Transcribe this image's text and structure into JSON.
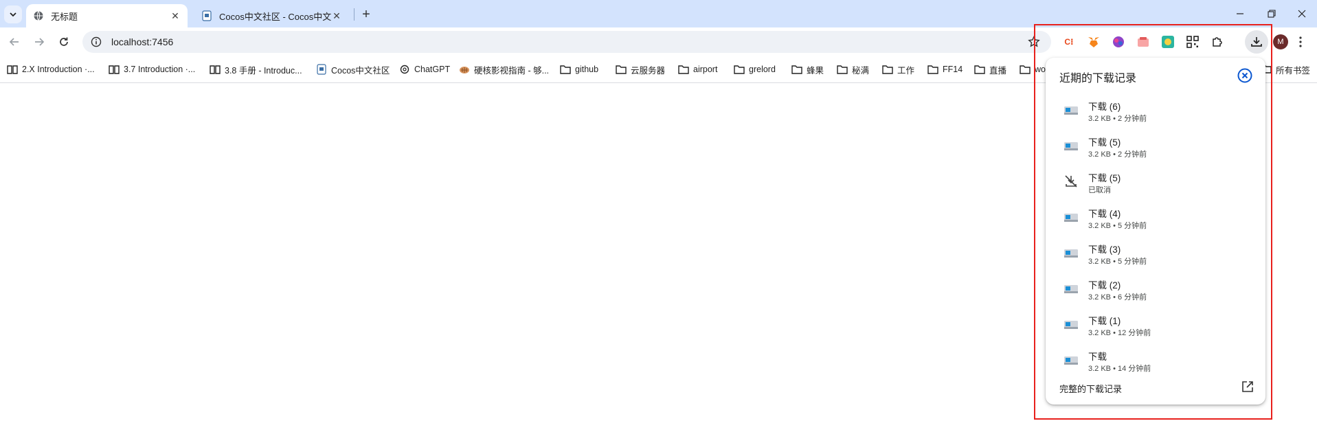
{
  "tabs": [
    {
      "title": "无标题",
      "favicon": "globe-icon",
      "active": true
    },
    {
      "title": "Cocos中文社区 - Cocos中文社",
      "favicon": "cocos-icon",
      "active": false
    }
  ],
  "address": {
    "url": "localhost:7456"
  },
  "toolbar": {
    "extensions": [
      "c-logo-icon",
      "metamask-icon",
      "brain-icon",
      "toolbox-icon",
      "translate-icon",
      "qr-code-icon",
      "puzzle-icon"
    ],
    "avatar_letter": "M"
  },
  "bookmarks": [
    {
      "label": "2.X Introduction ·...",
      "icon": "book-icon"
    },
    {
      "label": "3.7 Introduction ·...",
      "icon": "book-icon"
    },
    {
      "label": "3.8 手册 - Introduc...",
      "icon": "book-icon"
    },
    {
      "label": "Cocos中文社区",
      "icon": "cocos-icon"
    },
    {
      "label": "ChatGPT",
      "icon": "openai-icon"
    },
    {
      "label": "硬核影视指南 - 够...",
      "icon": "film-icon"
    },
    {
      "label": "github",
      "icon": "folder-icon"
    },
    {
      "label": "云服务器",
      "icon": "folder-icon"
    },
    {
      "label": "airport",
      "icon": "folder-icon"
    },
    {
      "label": "grelord",
      "icon": "folder-icon"
    },
    {
      "label": "蜂果",
      "icon": "folder-icon"
    },
    {
      "label": "秘满",
      "icon": "folder-icon"
    },
    {
      "label": "工作",
      "icon": "folder-icon"
    },
    {
      "label": "FF14",
      "icon": "folder-icon"
    },
    {
      "label": "直播",
      "icon": "folder-icon"
    },
    {
      "label": "wo",
      "icon": "folder-icon"
    }
  ],
  "bookmarks_all": "所有书签",
  "downloads": {
    "title": "近期的下载记录",
    "items": [
      {
        "name": "下载 (6)",
        "meta": "3.2 KB • 2 分钟前",
        "status": "done"
      },
      {
        "name": "下载 (5)",
        "meta": "3.2 KB • 2 分钟前",
        "status": "done"
      },
      {
        "name": "下载 (5)",
        "meta": "已取消",
        "status": "cancelled"
      },
      {
        "name": "下载 (4)",
        "meta": "3.2 KB • 5 分钟前",
        "status": "done"
      },
      {
        "name": "下载 (3)",
        "meta": "3.2 KB • 5 分钟前",
        "status": "done"
      },
      {
        "name": "下载 (2)",
        "meta": "3.2 KB • 6 分钟前",
        "status": "done"
      },
      {
        "name": "下载 (1)",
        "meta": "3.2 KB • 12 分钟前",
        "status": "done"
      },
      {
        "name": "下载",
        "meta": "3.2 KB • 14 分钟前",
        "status": "done"
      }
    ],
    "footer": "完整的下载记录"
  },
  "colors": {
    "accent": "#0b57d0",
    "highlight": "#e8201c",
    "tabstrip": "#d3e3fd"
  }
}
